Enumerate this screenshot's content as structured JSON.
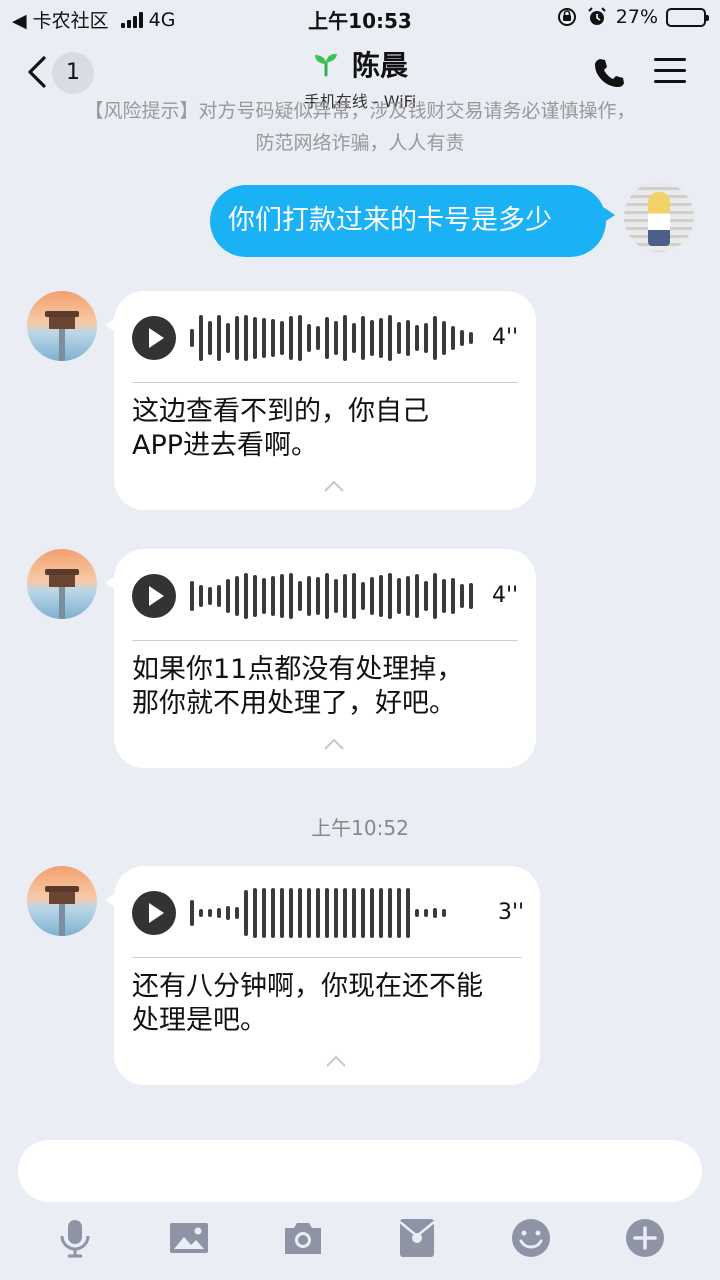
{
  "status_bar": {
    "back_app": "◀ 卡农社区",
    "network": "4G",
    "time": "上午10:53",
    "battery_percent": "27%",
    "battery_level": 0.27
  },
  "header": {
    "back_glyph": "〈",
    "unread_count": "1",
    "title": "陈晨",
    "subtitle": "手机在线 - WiFi"
  },
  "notice": {
    "line1": "【风险提示】对方号码疑似异常，涉及钱财交易请务必谨慎操作，",
    "line2": "防范网络诈骗，人人有责"
  },
  "messages": [
    {
      "type": "text",
      "from": "self",
      "text": "你们打款过来的卡号是多少"
    },
    {
      "type": "voice",
      "from": "other",
      "duration": "4''",
      "transcript": "这边查看不到的，你自己\nAPP进去看啊。"
    },
    {
      "type": "voice",
      "from": "other",
      "duration": "4''",
      "transcript": "如果你11点都没有处理掉，\n那你就不用处理了，好吧。"
    },
    {
      "type": "timestamp",
      "text": "上午10:52"
    },
    {
      "type": "voice",
      "from": "other",
      "duration": "3''",
      "transcript": "还有八分钟啊，你现在还不能\n处理是吧。"
    }
  ],
  "input": {
    "value": "",
    "placeholder": ""
  },
  "toolbar": {
    "icons": [
      "microphone-icon",
      "image-icon",
      "camera-icon",
      "red-packet-icon",
      "emoji-icon",
      "plus-icon"
    ]
  },
  "colors": {
    "background": "#ebedf5",
    "outgoing_bubble": "#1bb1f5",
    "incoming_bubble": "#ffffff",
    "toolbar_icon": "#8e93a6",
    "battery_fill": "#f5c400"
  }
}
